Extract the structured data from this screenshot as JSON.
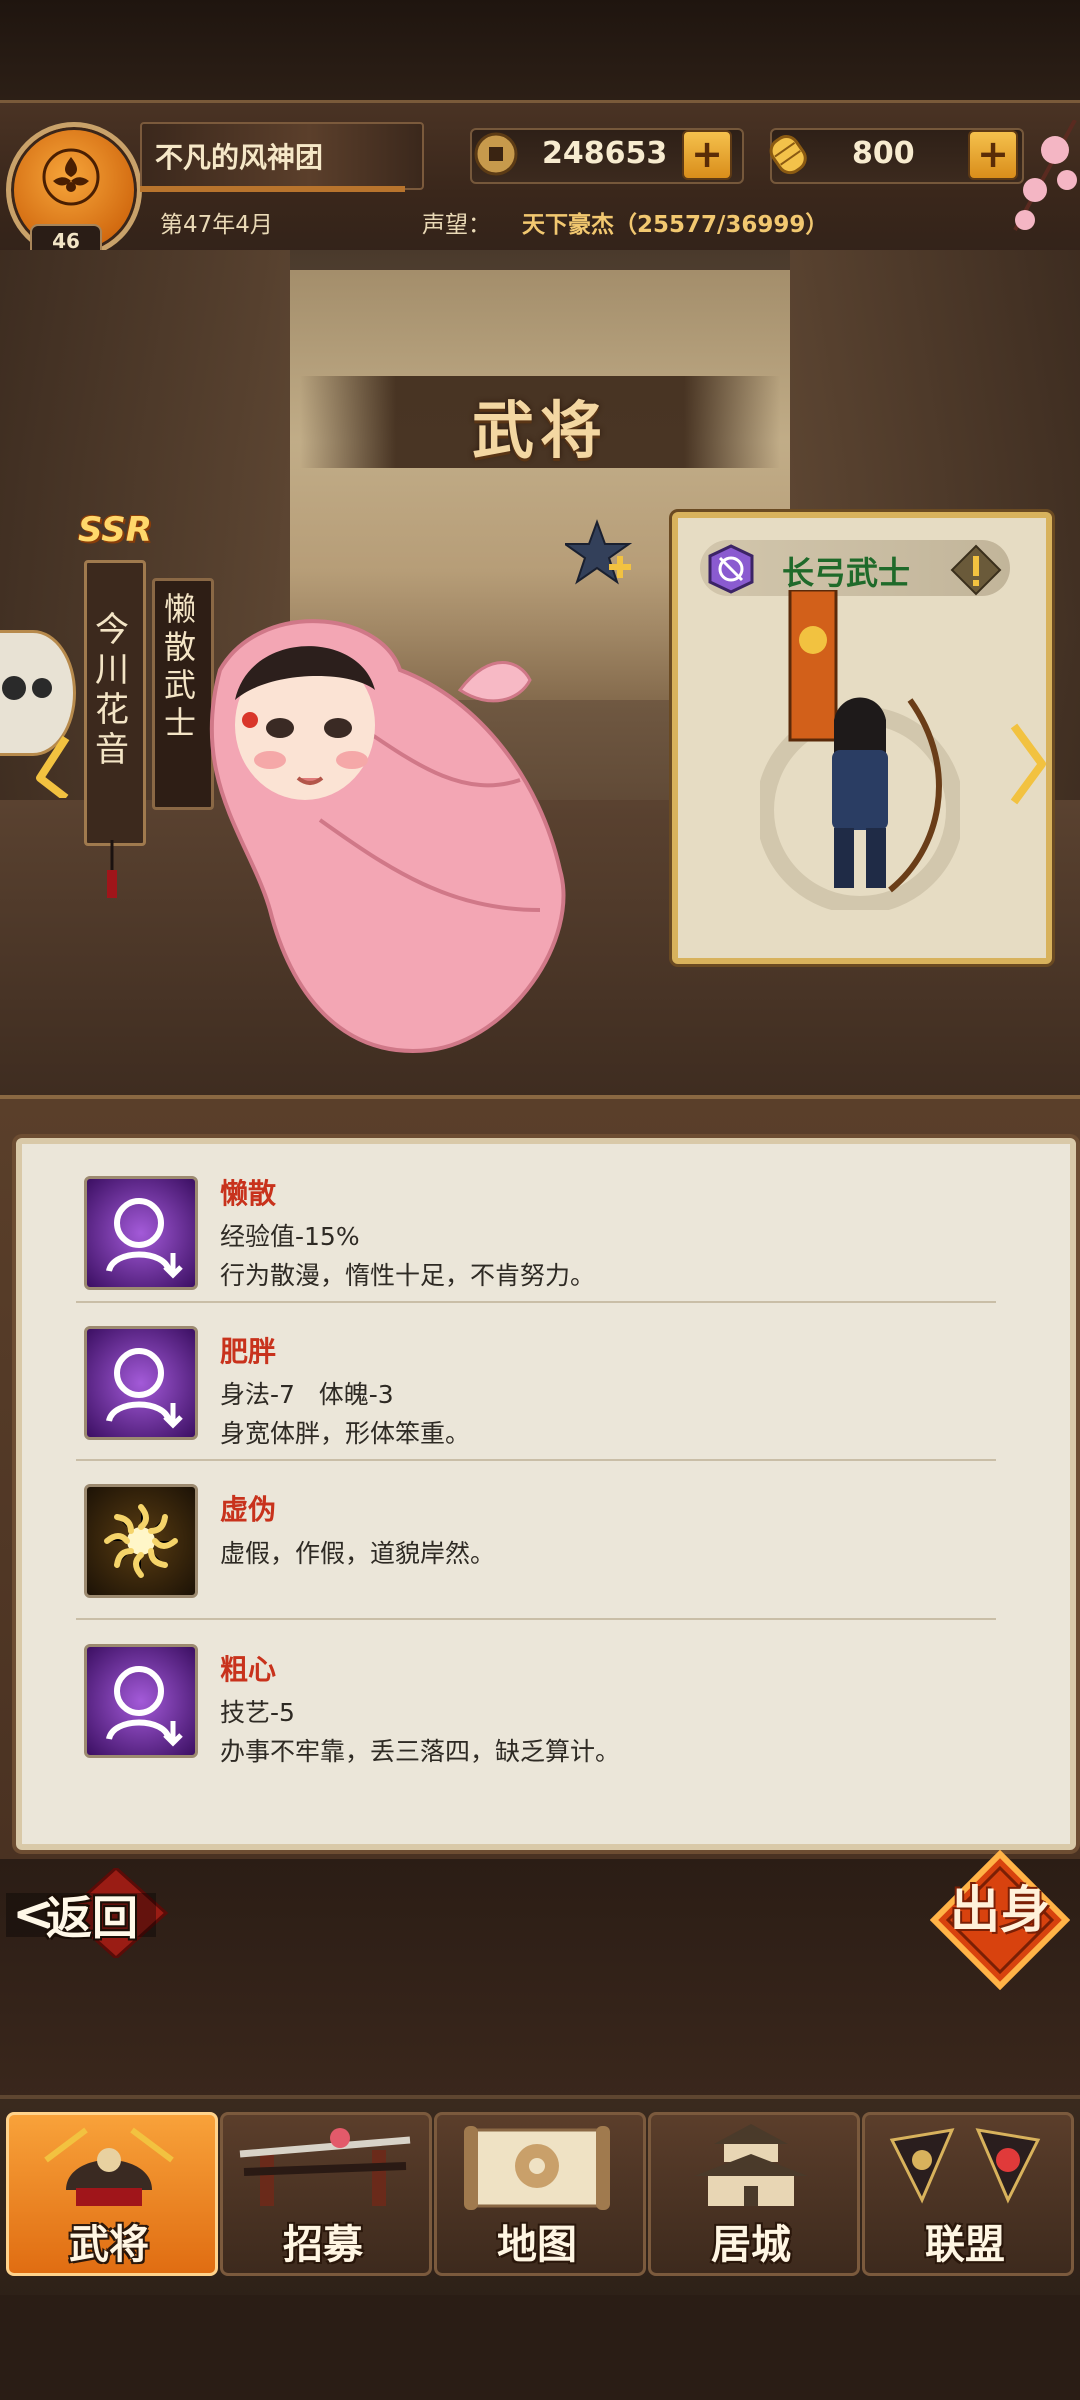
{
  "header": {
    "guild_name": "不凡的风神团",
    "level": "46",
    "date": "第47年4月",
    "prestige_label": "声望：",
    "prestige_value": "天下豪杰（25577/36999）",
    "copper": "248653",
    "gold": "800"
  },
  "stage": {
    "title": "武将",
    "rarity": "SSR",
    "hero_name": "今川花音",
    "hero_tag": "懒散武士",
    "unit_name": "长弓武士"
  },
  "traits": [
    {
      "title": "懒散",
      "line1": "经验值-15%",
      "line2": "行为散漫，惰性十足，不肯努力。"
    },
    {
      "title": "肥胖",
      "line1": "身法-7   体魄-3",
      "line2": "身宽体胖，形体笨重。"
    },
    {
      "title": "虚伪",
      "line1": "虚假，作假，道貌岸然。",
      "line2": ""
    },
    {
      "title": "粗心",
      "line1": "技艺-5",
      "line2": "办事不牢靠，丢三落四，缺乏算计。"
    }
  ],
  "buttons": {
    "back": "返回",
    "origin": "出身"
  },
  "nav": [
    {
      "label": "武将",
      "active": true
    },
    {
      "label": "招募",
      "active": false
    },
    {
      "label": "地图",
      "active": false
    },
    {
      "label": "居城",
      "active": false
    },
    {
      "label": "联盟",
      "active": false
    }
  ],
  "colors": {
    "accent": "#e06d12",
    "trait_title": "#c8321c",
    "unit_name": "#1f6a2a"
  }
}
